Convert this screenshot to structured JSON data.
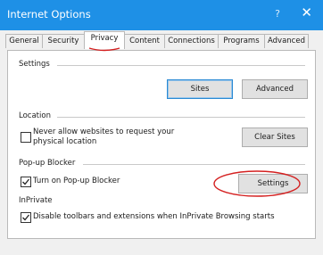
{
  "window": {
    "title": "Internet Options",
    "help": "?",
    "close": "✕"
  },
  "tabs": [
    {
      "label": "General",
      "active": false
    },
    {
      "label": "Security",
      "active": false
    },
    {
      "label": "Privacy",
      "active": true
    },
    {
      "label": "Content",
      "active": false
    },
    {
      "label": "Connections",
      "active": false
    },
    {
      "label": "Programs",
      "active": false
    },
    {
      "label": "Advanced",
      "active": false
    }
  ],
  "settings": {
    "heading": "Settings",
    "sites_label": "Sites",
    "advanced_label": "Advanced"
  },
  "location": {
    "heading": "Location",
    "never_allow_line1": "Never allow websites to request your",
    "never_allow_line2": "physical location",
    "never_allow_checked": false,
    "clear_sites_label": "Clear Sites"
  },
  "popup": {
    "heading": "Pop-up Blocker",
    "turn_on_label": "Turn on Pop-up Blocker",
    "turn_on_checked": true,
    "settings_label": "Settings"
  },
  "inprivate": {
    "heading": "InPrivate",
    "disable_label": "Disable toolbars and extensions when InPrivate Browsing starts",
    "disable_checked": true
  },
  "colors": {
    "titlebar": "#1e90e6",
    "annotation": "#d42020",
    "focus": "#2a8ad4"
  }
}
